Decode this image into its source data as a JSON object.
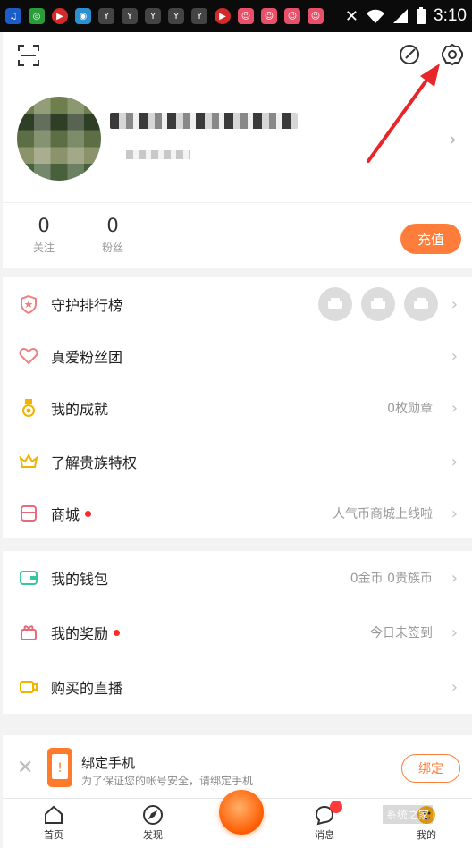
{
  "status_bar": {
    "time": "3:10"
  },
  "profile": {
    "follow_count": "0",
    "follow_label": "关注",
    "fans_count": "0",
    "fans_label": "粉丝",
    "recharge_label": "充值"
  },
  "section1": [
    {
      "label": "守护排行榜",
      "value": "",
      "icon": "guard-rank-icon",
      "dot": false
    },
    {
      "label": "真爱粉丝团",
      "value": "",
      "icon": "fan-club-icon",
      "dot": false
    },
    {
      "label": "我的成就",
      "value": "0枚勋章",
      "icon": "medal-icon",
      "dot": false
    },
    {
      "label": "了解贵族特权",
      "value": "",
      "icon": "crown-icon",
      "dot": false
    },
    {
      "label": "商城",
      "value": "人气币商城上线啦",
      "icon": "shop-icon",
      "dot": true
    }
  ],
  "section2": [
    {
      "label": "我的钱包",
      "value": "0金币 0贵族币",
      "icon": "wallet-icon",
      "dot": false
    },
    {
      "label": "我的奖励",
      "value": "今日未签到",
      "icon": "gift-icon",
      "dot": true
    },
    {
      "label": "购买的直播",
      "value": "",
      "icon": "video-icon",
      "dot": false
    }
  ],
  "bind_phone": {
    "title": "绑定手机",
    "desc": "为了保证您的帐号安全，请绑定手机",
    "button": "绑定"
  },
  "tabs": [
    {
      "label": "首页",
      "icon": "home-icon"
    },
    {
      "label": "发现",
      "icon": "compass-icon"
    },
    {
      "label": "",
      "icon": "live-icon"
    },
    {
      "label": "消息",
      "icon": "message-icon"
    },
    {
      "label": "我的",
      "icon": "profile-icon"
    }
  ],
  "watermark": "系统之家",
  "colors": {
    "accent": "#ff7d3b",
    "red_dot": "#ff2a2a",
    "annotation": "#e8262a"
  }
}
